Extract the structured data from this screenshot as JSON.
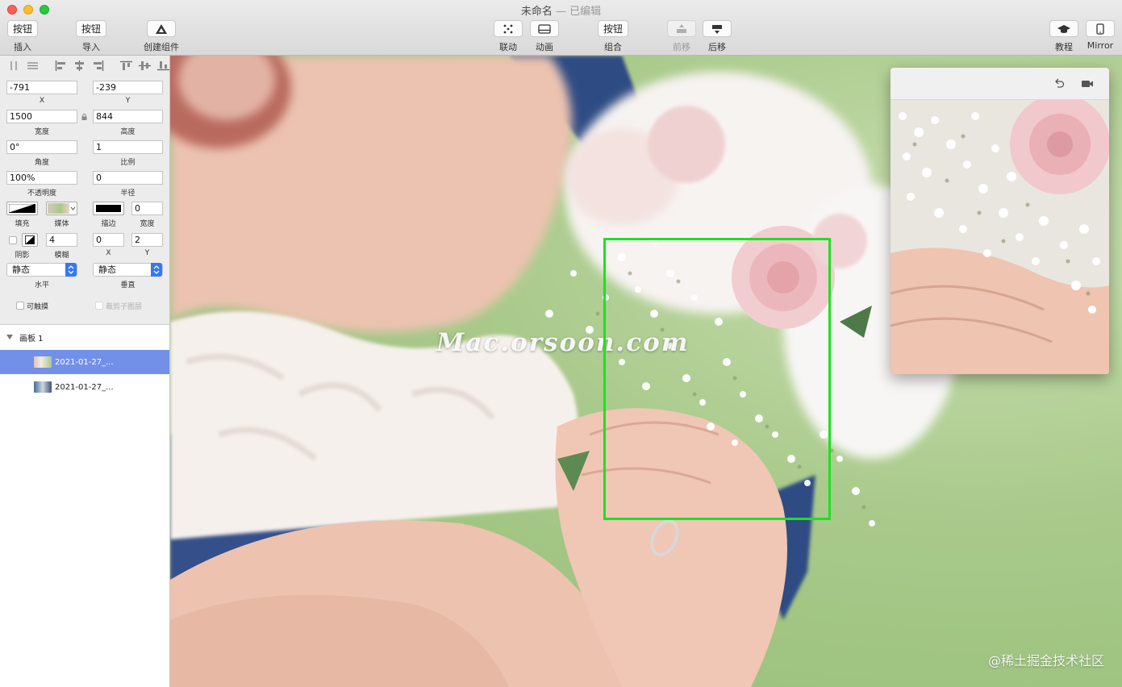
{
  "window": {
    "title": "未命名",
    "status": " — 已编辑"
  },
  "toolbar": {
    "insert": {
      "button": "按钮",
      "label": "插入"
    },
    "import": {
      "button": "按钮",
      "label": "导入"
    },
    "create_component": {
      "label": "创建组件"
    },
    "link": {
      "label": "联动"
    },
    "animate": {
      "label": "动画"
    },
    "group": {
      "button": "按钮",
      "label": "组合"
    },
    "bring_forward": {
      "label": "前移"
    },
    "send_backward": {
      "label": "后移"
    },
    "tutorial": {
      "label": "教程"
    },
    "mirror": {
      "label": "Mirror"
    }
  },
  "inspector": {
    "x": {
      "value": "-791",
      "label": "X"
    },
    "y": {
      "value": "-239",
      "label": "Y"
    },
    "width": {
      "value": "1500",
      "label": "宽度"
    },
    "height": {
      "value": "844",
      "label": "高度"
    },
    "angle": {
      "value": "0°",
      "label": "角度"
    },
    "scale": {
      "value": "1",
      "label": "比例"
    },
    "opacity": {
      "value": "100%",
      "label": "不透明度"
    },
    "radius": {
      "value": "0",
      "label": "半径"
    },
    "fill": {
      "label": "填充"
    },
    "media": {
      "label": "媒体"
    },
    "stroke": {
      "label": "描边"
    },
    "stroke_width": {
      "value": "0",
      "label": "宽度"
    },
    "shadow": {
      "label": "阴影"
    },
    "blur": {
      "value": "4",
      "label": "模糊"
    },
    "shadow_x": {
      "value": "0",
      "label": "X"
    },
    "shadow_y": {
      "value": "2",
      "label": "Y"
    },
    "horizontal": {
      "value": "静态",
      "label": "水平"
    },
    "vertical": {
      "value": "静态",
      "label": "垂直"
    },
    "touchable": {
      "label": "可触摸"
    },
    "clip_children": {
      "label": "裁剪子图层"
    }
  },
  "layers": {
    "group": "画板 1",
    "items": [
      {
        "name": "2021-01-27_...",
        "selected": true
      },
      {
        "name": "2021-01-27_...",
        "selected": false
      }
    ]
  },
  "canvas": {
    "watermark": "Mac.orsoon.com",
    "corner_watermark": "@稀土掘金技术社区",
    "selection_color": "#1ee022"
  },
  "colors": {
    "accent": "#3478f6",
    "selected_layer": "#7390e8"
  }
}
